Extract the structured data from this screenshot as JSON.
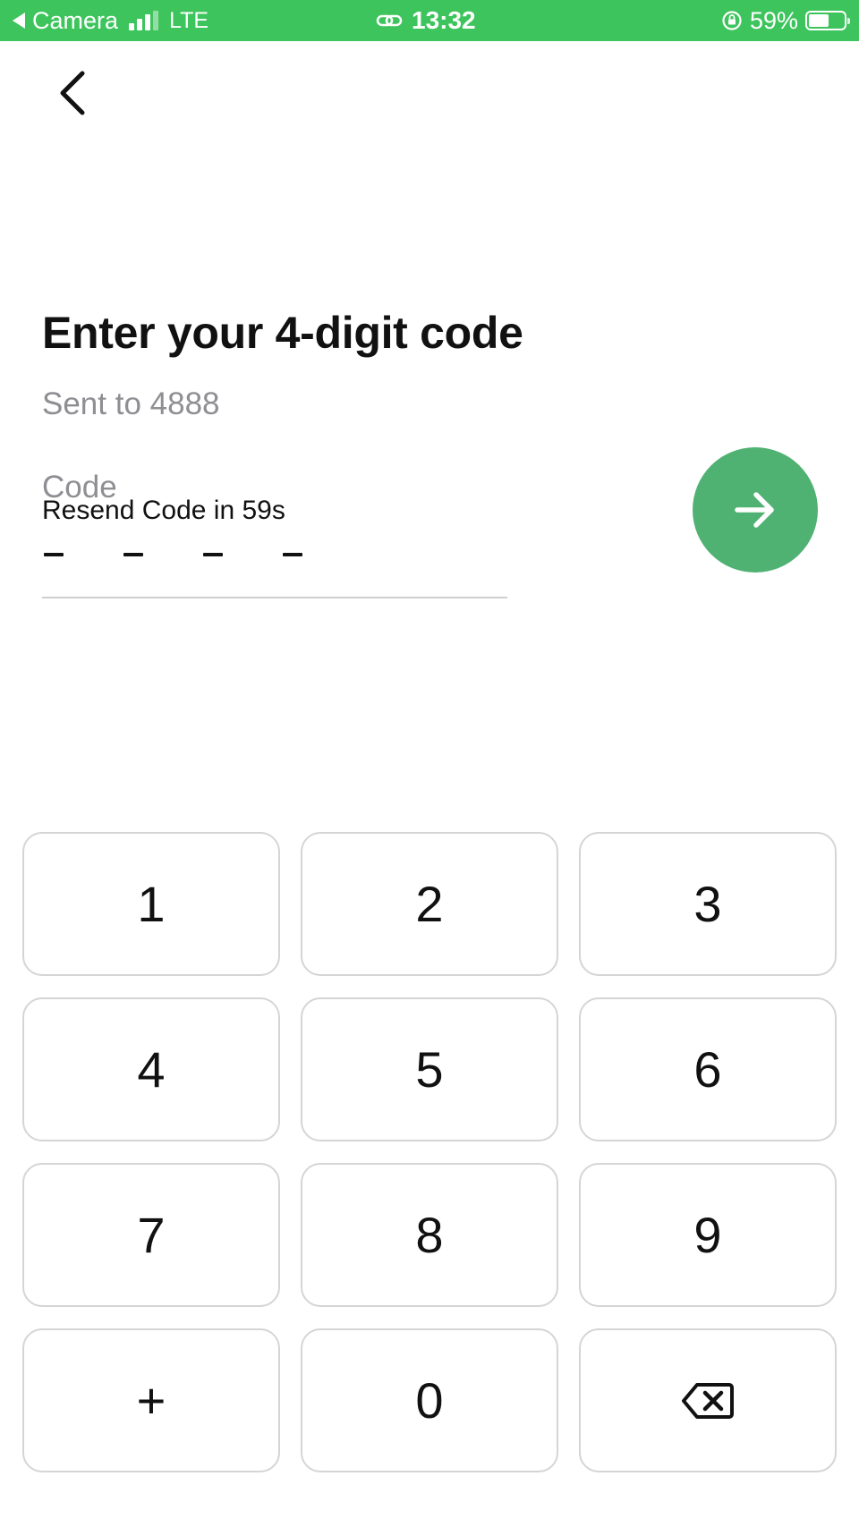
{
  "status_bar": {
    "back_app": "Camera",
    "network": "LTE",
    "time": "13:32",
    "battery_percent": "59%",
    "battery_level": 0.59,
    "background_color": "#3dc45c"
  },
  "header": {
    "back_icon": "chevron-left-icon"
  },
  "main": {
    "title": "Enter your 4-digit code",
    "subtitle": "Sent to 4888",
    "code_label": "Code",
    "resend_text": "Resend Code in 59s",
    "code_slots": [
      "-",
      "-",
      "-",
      "-"
    ],
    "next_button_color": "#4fb273",
    "next_icon": "arrow-right-icon"
  },
  "keypad": {
    "keys": [
      {
        "label": "1",
        "name": "key-1"
      },
      {
        "label": "2",
        "name": "key-2"
      },
      {
        "label": "3",
        "name": "key-3"
      },
      {
        "label": "4",
        "name": "key-4"
      },
      {
        "label": "5",
        "name": "key-5"
      },
      {
        "label": "6",
        "name": "key-6"
      },
      {
        "label": "7",
        "name": "key-7"
      },
      {
        "label": "8",
        "name": "key-8"
      },
      {
        "label": "9",
        "name": "key-9"
      },
      {
        "label": "+",
        "name": "key-plus"
      },
      {
        "label": "0",
        "name": "key-0"
      },
      {
        "label": "",
        "name": "key-backspace",
        "icon": "backspace-icon"
      }
    ]
  }
}
